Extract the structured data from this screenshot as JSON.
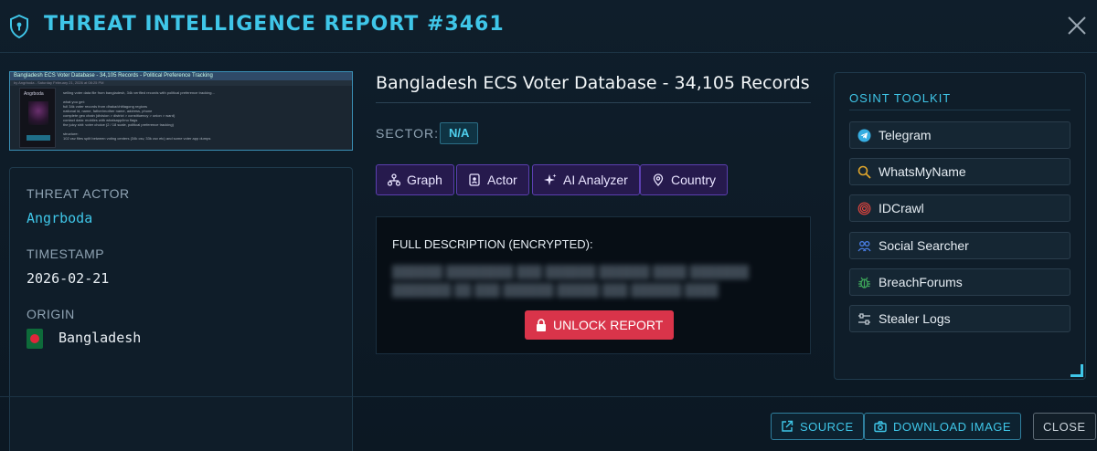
{
  "header": {
    "title": "THREAT INTELLIGENCE REPORT #3461",
    "shield_icon": "shield-icon",
    "close_icon": "close-icon"
  },
  "thumbnail": {
    "bar_text": "Bangladesh ECS Voter Database - 34,105 Records - Political Preference Tracking",
    "sub_text": "by Angrboda - Saturday February 21, 2026 at 08:25 PM",
    "side_name": "Angrboda",
    "body_text": "selling voter data file from bangladesh, 34k verified records with political preference tracking...\n\nwhat you get:\nfull 34k voter records from dhaka/chittagong regions\nnational id, name, father/mother name, address, phone\ncomplete geo chain (division > district > constituency > union > ward)\ncontact data: mobiles with whatsapp/imo flags\nthe juicy shit: voter choice (2 / 18 scale, political preference tracking)\n\nstructure:\n102 csv files split between voting centers (34k csv, 33k csv etc) and some voter app dumps"
  },
  "left": {
    "threat_actor_label": "THREAT ACTOR",
    "threat_actor": "Angrboda",
    "timestamp_label": "TIMESTAMP",
    "timestamp": "2026-02-21",
    "origin_label": "ORIGIN",
    "origin": "Bangladesh",
    "flag_colors": {
      "field": "#0e6b3a",
      "disc": "#e0263a"
    }
  },
  "center": {
    "record_title": "Bangladesh ECS Voter Database - 34,105 Records",
    "sector_label": "SECTOR:",
    "sector": "N/A",
    "tools": [
      {
        "label": "Graph",
        "icon": "graph-icon"
      },
      {
        "label": "Actor",
        "icon": "id-card-icon"
      },
      {
        "label": "AI Analyzer",
        "icon": "sparkle-icon"
      },
      {
        "label": "Country",
        "icon": "map-pin-icon"
      }
    ],
    "description_label": "FULL DESCRIPTION (ENCRYPTED):",
    "encrypted_placeholder": "██████ ████████ ███ ██████ ██████ ████ ███████ ███████ ██ ███ ██████ █████ ███ ██████ ████",
    "unlock_label": "UNLOCK REPORT",
    "unlock_icon": "lock-icon"
  },
  "osint": {
    "title": "OSINT TOOLKIT",
    "items": [
      {
        "label": "Telegram",
        "icon": "telegram-icon",
        "color": "#37aee2"
      },
      {
        "label": "WhatsMyName",
        "icon": "search-icon",
        "color": "#e0a62c"
      },
      {
        "label": "IDCrawl",
        "icon": "fingerprint-icon",
        "color": "#e0453f"
      },
      {
        "label": "Social Searcher",
        "icon": "users-icon",
        "color": "#4a7fe8"
      },
      {
        "label": "BreachForums",
        "icon": "bug-icon",
        "color": "#3ea85a"
      },
      {
        "label": "Stealer Logs",
        "icon": "sliders-icon",
        "color": "#c9d2da"
      }
    ]
  },
  "footer": {
    "source_label": "SOURCE",
    "download_label": "DOWNLOAD IMAGE",
    "close_label": "CLOSE"
  },
  "colors": {
    "accent": "#3fc6e8",
    "purple_button": "#261a4d",
    "unlock_red": "#d9344a",
    "background": "#0f1e2b"
  }
}
